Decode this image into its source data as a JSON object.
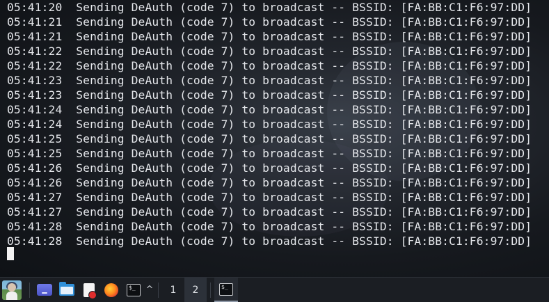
{
  "terminal": {
    "lines": [
      {
        "time": "05:41:20",
        "text": "Sending DeAuth (code 7) to broadcast -- BSSID: [FA:BB:C1:F6:97:DD]"
      },
      {
        "time": "05:41:21",
        "text": "Sending DeAuth (code 7) to broadcast -- BSSID: [FA:BB:C1:F6:97:DD]"
      },
      {
        "time": "05:41:21",
        "text": "Sending DeAuth (code 7) to broadcast -- BSSID: [FA:BB:C1:F6:97:DD]"
      },
      {
        "time": "05:41:22",
        "text": "Sending DeAuth (code 7) to broadcast -- BSSID: [FA:BB:C1:F6:97:DD]"
      },
      {
        "time": "05:41:22",
        "text": "Sending DeAuth (code 7) to broadcast -- BSSID: [FA:BB:C1:F6:97:DD]"
      },
      {
        "time": "05:41:23",
        "text": "Sending DeAuth (code 7) to broadcast -- BSSID: [FA:BB:C1:F6:97:DD]"
      },
      {
        "time": "05:41:23",
        "text": "Sending DeAuth (code 7) to broadcast -- BSSID: [FA:BB:C1:F6:97:DD]"
      },
      {
        "time": "05:41:24",
        "text": "Sending DeAuth (code 7) to broadcast -- BSSID: [FA:BB:C1:F6:97:DD]"
      },
      {
        "time": "05:41:24",
        "text": "Sending DeAuth (code 7) to broadcast -- BSSID: [FA:BB:C1:F6:97:DD]"
      },
      {
        "time": "05:41:25",
        "text": "Sending DeAuth (code 7) to broadcast -- BSSID: [FA:BB:C1:F6:97:DD]"
      },
      {
        "time": "05:41:25",
        "text": "Sending DeAuth (code 7) to broadcast -- BSSID: [FA:BB:C1:F6:97:DD]"
      },
      {
        "time": "05:41:26",
        "text": "Sending DeAuth (code 7) to broadcast -- BSSID: [FA:BB:C1:F6:97:DD]"
      },
      {
        "time": "05:41:26",
        "text": "Sending DeAuth (code 7) to broadcast -- BSSID: [FA:BB:C1:F6:97:DD]"
      },
      {
        "time": "05:41:27",
        "text": "Sending DeAuth (code 7) to broadcast -- BSSID: [FA:BB:C1:F6:97:DD]"
      },
      {
        "time": "05:41:27",
        "text": "Sending DeAuth (code 7) to broadcast -- BSSID: [FA:BB:C1:F6:97:DD]"
      },
      {
        "time": "05:41:28",
        "text": "Sending DeAuth (code 7) to broadcast -- BSSID: [FA:BB:C1:F6:97:DD]"
      },
      {
        "time": "05:41:28",
        "text": "Sending DeAuth (code 7) to broadcast -- BSSID: [FA:BB:C1:F6:97:DD]"
      }
    ]
  },
  "taskbar": {
    "launchers": [
      {
        "icon": "user-avatar"
      },
      {
        "icon": "show-desktop-icon"
      },
      {
        "icon": "file-manager-icon"
      },
      {
        "icon": "text-editor-icon"
      },
      {
        "icon": "firefox-icon"
      },
      {
        "icon": "terminal-icon"
      }
    ],
    "chevron": "^",
    "terminal_icon_glyph": "$_",
    "workspaces": [
      "1",
      "2"
    ],
    "active_workspace": "2"
  },
  "colors": {
    "terminal_text": "#e4e6ea",
    "taskbar_bg": "#1b1e23"
  }
}
